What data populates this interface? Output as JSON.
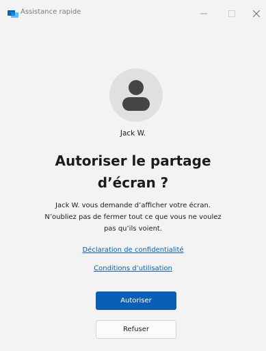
{
  "window": {
    "title": "Assistance rapide",
    "app_icon": "quick-assist-icon",
    "controls": {
      "minimize_icon": "minimize-icon",
      "maximize_icon": "maximize-icon",
      "close_icon": "close-icon"
    }
  },
  "requester": {
    "avatar_icon": "person-icon",
    "name": "Jack W."
  },
  "dialog": {
    "title_line1": "Autoriser le partage",
    "title_line2": "d’écran ?",
    "description_line1": "Jack W. vous demande d’afficher votre écran.",
    "description_line2": "N’oubliez pas de fermer tout ce que vous ne voulez",
    "description_line3": "pas qu’ils voient."
  },
  "links": {
    "privacy": "Déclaration de confidentialité",
    "terms": "Conditions d’utilisation"
  },
  "buttons": {
    "allow": "Autoriser",
    "deny": "Refuser"
  },
  "colors": {
    "accent": "#0a5fb4",
    "background": "#f3f3f3",
    "avatar_bg": "#e0e0e0",
    "avatar_fg": "#454545"
  }
}
